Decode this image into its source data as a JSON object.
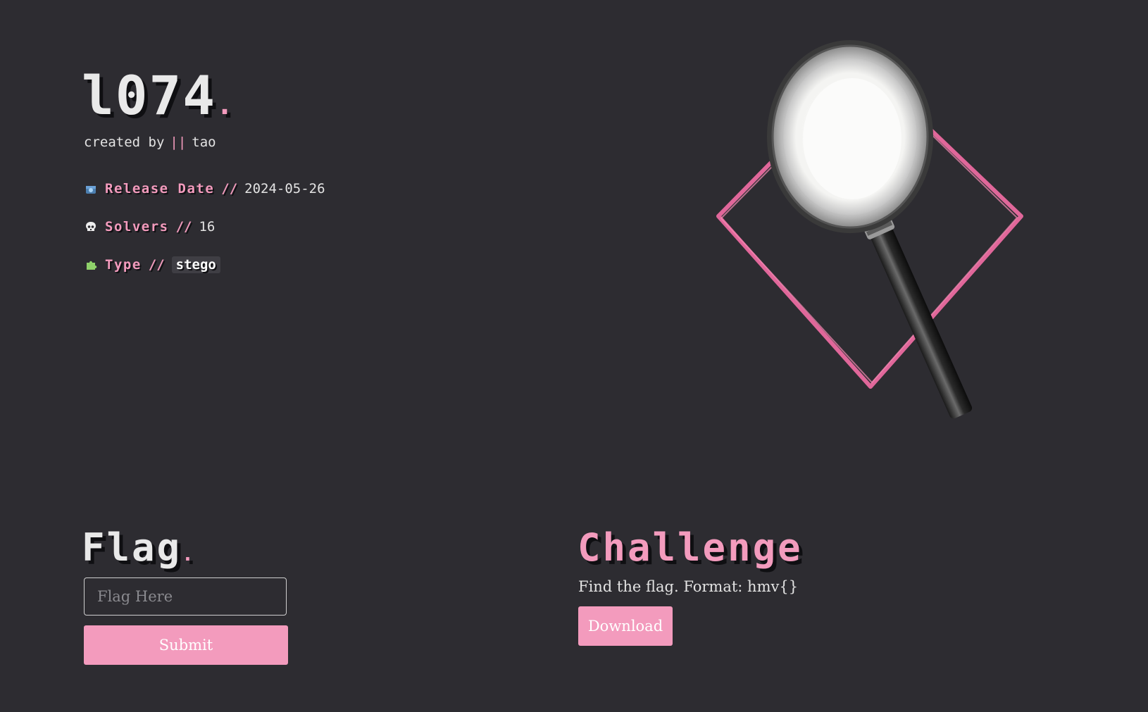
{
  "machine": {
    "title": "l074",
    "title_dot": ".",
    "created_by_label": "created by",
    "separator": "||",
    "author": "tao"
  },
  "meta": {
    "release_label": "Release Date",
    "release_sep": "//",
    "release_value": "2024-05-26",
    "solvers_label": "Solvers",
    "solvers_sep": "//",
    "solvers_value": "16",
    "type_label": "Type",
    "type_sep": "//",
    "type_value": "stego"
  },
  "icons": {
    "release": "calendar-icon",
    "solvers": "skull-icon",
    "type": "puzzle-icon"
  },
  "flag": {
    "title": "Flag",
    "title_dot": ".",
    "placeholder": "Flag Here",
    "value": "",
    "submit_label": "Submit"
  },
  "challenge": {
    "title": "Challenge",
    "description": "Find the flag. Format: hmv{}",
    "download_label": "Download"
  },
  "colors": {
    "background": "#2d2c31",
    "accent": "#f39bbd",
    "text": "#e8e8e8"
  }
}
